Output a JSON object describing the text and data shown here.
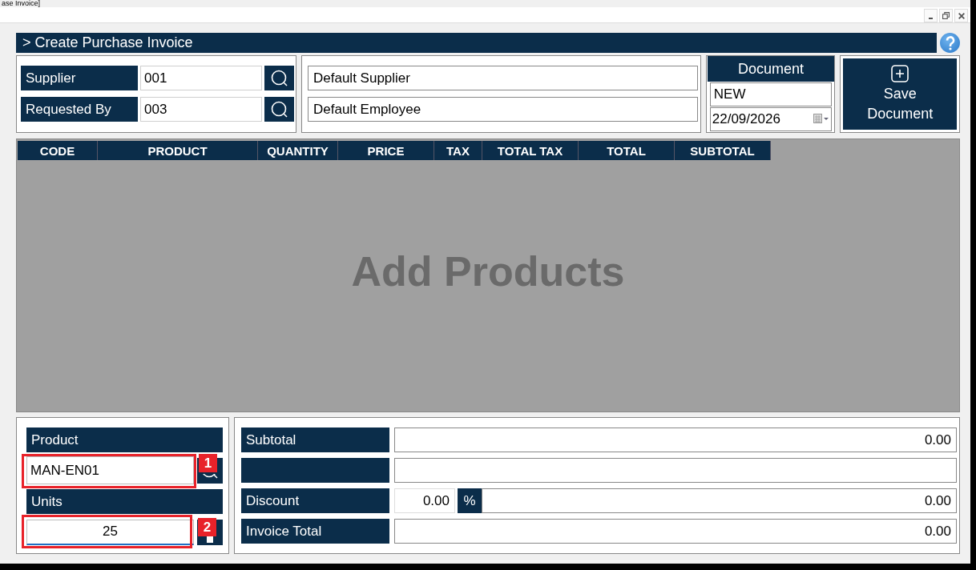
{
  "window": {
    "title": "ase Invoice]"
  },
  "page": {
    "title": "> Create Purchase Invoice"
  },
  "lookups": [
    {
      "label": "Supplier",
      "value": "001",
      "description": "Default Supplier"
    },
    {
      "label": "Requested By",
      "value": "003",
      "description": "Default Employee"
    }
  ],
  "document": {
    "heading": "Document",
    "number": "NEW",
    "date": "22/09/2026"
  },
  "save_button": {
    "label": "Save Document"
  },
  "table": {
    "columns": [
      "CODE",
      "PRODUCT",
      "QUANTITY",
      "PRICE",
      "TAX",
      "TOTAL TAX",
      "TOTAL",
      "SUBTOTAL"
    ],
    "empty_message": "Add Products"
  },
  "entry": {
    "product_label": "Product",
    "product_value": "MAN-EN01",
    "units_label": "Units",
    "units_value": "25",
    "units_focused": true
  },
  "annotations": [
    {
      "number": "1"
    },
    {
      "number": "2"
    }
  ],
  "totals": [
    {
      "kind": "amount",
      "label": "Subtotal",
      "value": "0.00"
    },
    {
      "kind": "blank"
    },
    {
      "kind": "discount",
      "label": "Discount",
      "rate": "0.00",
      "rate_unit": "%",
      "value": "0.00"
    },
    {
      "kind": "amount",
      "label": "Invoice Total",
      "value": "0.00"
    }
  ]
}
